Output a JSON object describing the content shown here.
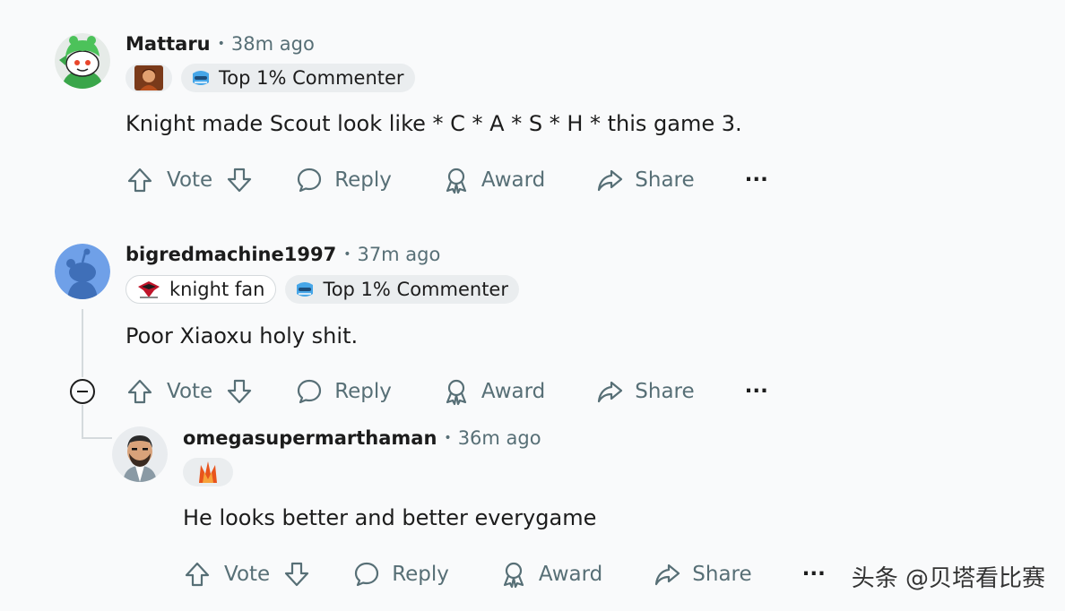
{
  "comments": [
    {
      "username": "Mattaru",
      "time": "38m ago",
      "flair_text": "Top 1% Commenter",
      "text": "Knight made Scout look like * C * A * S * H * this game 3."
    },
    {
      "username": "bigredmachine1997",
      "time": "37m ago",
      "team_flair_text": "knight fan",
      "flair_text": "Top 1% Commenter",
      "text": "Poor Xiaoxu holy shit."
    },
    {
      "username": "omegasupermarthaman",
      "time": "36m ago",
      "text": "He looks better and better everygame"
    }
  ],
  "actions": {
    "vote": "Vote",
    "reply": "Reply",
    "award": "Award",
    "share": "Share",
    "more": "···"
  },
  "separator": "•",
  "watermark": "头条 @贝塔看比赛",
  "icons": [
    "upvote-icon",
    "downvote-icon",
    "reply-bubble-icon",
    "award-icon",
    "share-arrow-icon",
    "more-icon",
    "collapse-icon"
  ],
  "colors": {
    "background": "#f9fafb",
    "text": "#1c1c1c",
    "meta": "#576f76",
    "flair_bg": "#eaedef"
  }
}
